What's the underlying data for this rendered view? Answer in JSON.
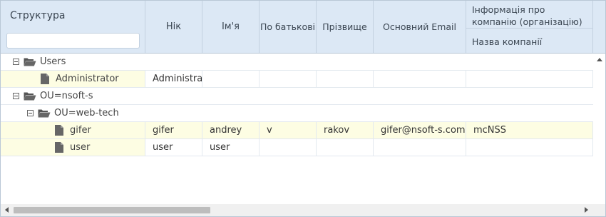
{
  "header": {
    "structure": "Структура",
    "search_placeholder": "",
    "nick": "Нік",
    "first_name": "Ім'я",
    "patronymic": "По батькові",
    "surname": "Прізвище",
    "email": "Основний Email",
    "company_group": "Інформація про компанію (організацію)",
    "company_name": "Назва компанії"
  },
  "tree": [
    {
      "label": "Users",
      "type": "folder",
      "level": 0
    },
    {
      "label": "Administrator",
      "type": "file",
      "level": 1,
      "nick": "Administrat",
      "first_name": "",
      "patronymic": "",
      "surname": "",
      "email": "",
      "company": ""
    },
    {
      "label": "OU=nsoft-s",
      "type": "folder",
      "level": 0
    },
    {
      "label": "OU=web-tech",
      "type": "folder",
      "level": 1
    },
    {
      "label": "gifer",
      "type": "file",
      "level": 2,
      "nick": "gifer",
      "first_name": "andrey",
      "patronymic": "v",
      "surname": "rakov",
      "email": "gifer@nsoft-s.com",
      "company": "mcNSS"
    },
    {
      "label": "user",
      "type": "file",
      "level": 2,
      "nick": "user",
      "first_name": "user",
      "patronymic": "",
      "surname": "",
      "email": "",
      "company": ""
    }
  ],
  "colors": {
    "header_bg": "#dce8f5",
    "row_highlight": "#fdfde3",
    "border": "#b9c7d6"
  }
}
